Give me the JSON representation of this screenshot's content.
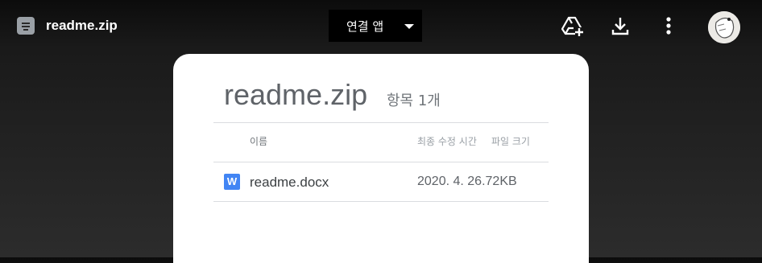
{
  "header": {
    "title": "readme.zip",
    "file_icon": "zip-file-icon",
    "open_with_label": "연결 앱",
    "actions": [
      "add-to-drive-icon",
      "download-icon",
      "more-vert-icon"
    ],
    "avatar": "avatar"
  },
  "card": {
    "title": "readme.zip",
    "item_count": "항목 1개",
    "columns": {
      "name": "이름",
      "modified": "최종 수정 시간",
      "size": "파일 크기"
    },
    "files": [
      {
        "icon": "word-doc-icon",
        "icon_letter": "W",
        "name": "readme.docx",
        "modified_size": "2020. 4. 26.72KB"
      }
    ]
  },
  "colors": {
    "background_top": "#0c0c0c",
    "background_bottom": "#2c2c2c",
    "card": "#ffffff",
    "word_blue": "#4285f4"
  }
}
